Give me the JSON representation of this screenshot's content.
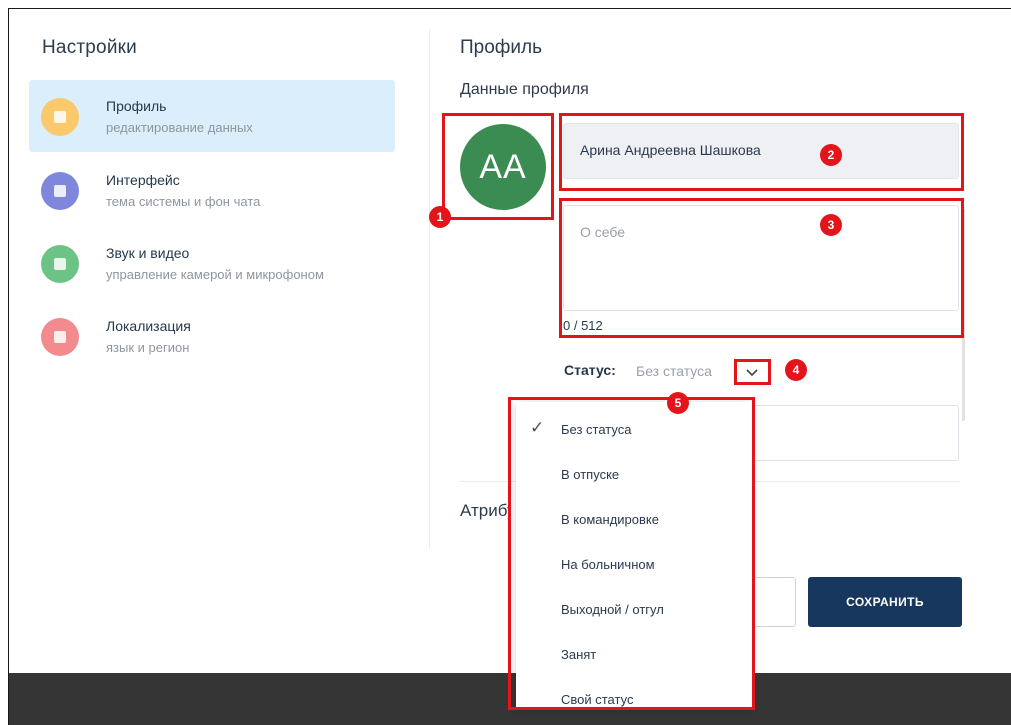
{
  "settings": {
    "title": "Настройки",
    "items": [
      {
        "label": "Профиль",
        "sub": "редактирование данных",
        "color": "#f9c96b",
        "active": true
      },
      {
        "label": "Интерфейс",
        "sub": "тема системы и фон чата",
        "color": "#7f87dd",
        "active": false
      },
      {
        "label": "Звук и видео",
        "sub": "управление камерой и микрофоном",
        "color": "#6cc386",
        "active": false
      },
      {
        "label": "Локализация",
        "sub": "язык и регион",
        "color": "#f28a8e",
        "active": false
      }
    ]
  },
  "profile": {
    "title": "Профиль",
    "subtitle": "Данные профиля",
    "avatar_initials": "AA",
    "avatar_color": "#3b8c52",
    "name_value": "Арина Андреевна Шашкова",
    "about_placeholder": "О себе",
    "about_counter": "0 / 512",
    "status_label": "Статус:",
    "status_value": "Без статуса",
    "attributes_title": "Атрибуты"
  },
  "status_options": [
    {
      "label": "Без статуса",
      "selected": true
    },
    {
      "label": "В отпуске",
      "selected": false
    },
    {
      "label": "В командировке",
      "selected": false
    },
    {
      "label": "На больничном",
      "selected": false
    },
    {
      "label": "Выходной / отгул",
      "selected": false
    },
    {
      "label": "Занят",
      "selected": false
    },
    {
      "label": "Свой статус",
      "selected": false
    }
  ],
  "actions": {
    "save_label": "СОХРАНИТЬ"
  },
  "annotations": [
    "1",
    "2",
    "3",
    "4",
    "5"
  ],
  "colors": {
    "annotation": "#e3151a",
    "save_button": "#17375e",
    "active_item": "#dbeefb"
  }
}
